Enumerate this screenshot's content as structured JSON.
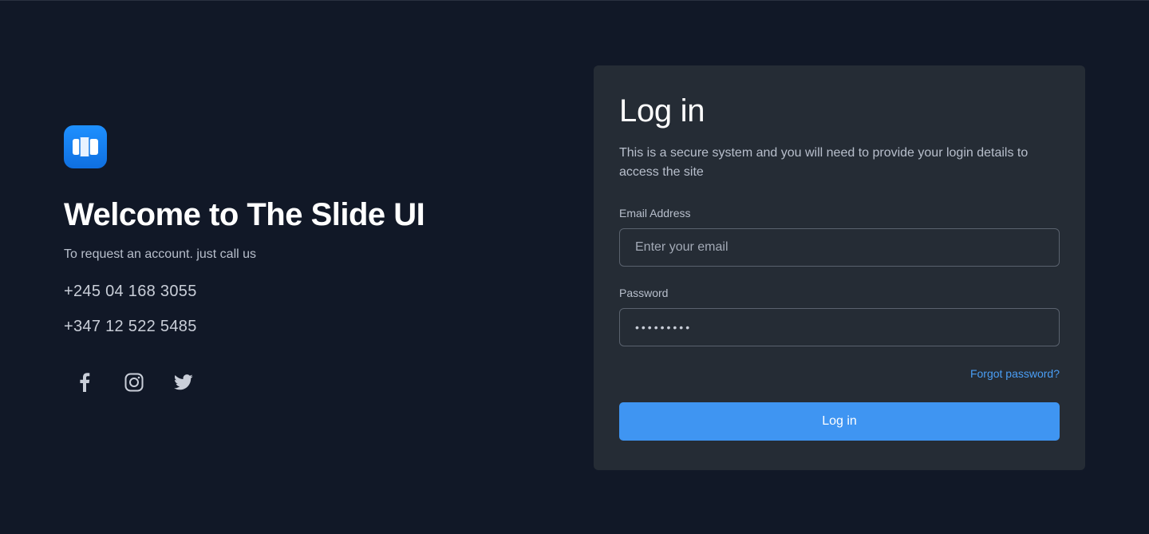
{
  "brand": {
    "logo_icon": "slides-logo-icon",
    "accent_color": "#1e90ff"
  },
  "welcome": {
    "title": "Welcome to The Slide UI",
    "subtitle": "To request an account. just call us",
    "phones": [
      "+245 04 168 3055",
      "+347 12 522 5485"
    ]
  },
  "socials": [
    {
      "name": "facebook-icon"
    },
    {
      "name": "instagram-icon"
    },
    {
      "name": "twitter-icon"
    }
  ],
  "login": {
    "title": "Log in",
    "description": "This is a secure system and you will need to provide your login details to access the site",
    "email_label": "Email Address",
    "email_placeholder": "Enter your email",
    "password_label": "Password",
    "password_value": "•••••••••",
    "forgot_label": "Forgot password?",
    "submit_label": "Log in",
    "button_color": "#3f95f2",
    "link_color": "#4a9ef5"
  }
}
